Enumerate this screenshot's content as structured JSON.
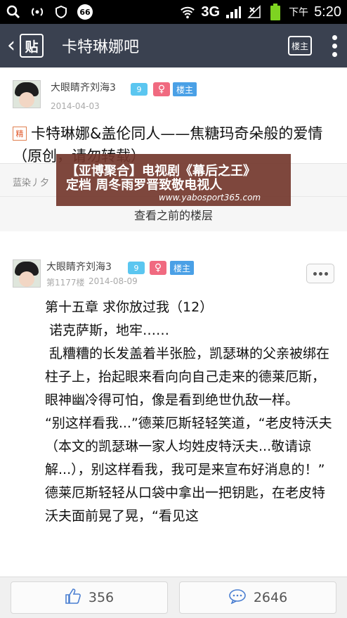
{
  "status_bar": {
    "notification_count": "66",
    "network": "3G",
    "time_prefix": "下午",
    "time": "5:20"
  },
  "app_bar": {
    "logo_text": "贴",
    "title": "卡特琳娜吧",
    "host_only_label": "楼主"
  },
  "post": {
    "author": "大眼睛齐刘海3",
    "level": "9",
    "gender_symbol": "♀",
    "host_tag": "楼主",
    "date": "2014-04-03",
    "essence_tag": "精",
    "title": "卡特琳娜&盖伦同人——焦糖玛奇朵般的爱情（原创，请勿转载）",
    "forum_row": "蓝染丿夕"
  },
  "view_previous_label": "查看之前的楼层",
  "floor": {
    "author": "大眼睛齐刘海3",
    "level": "9",
    "gender_symbol": "♀",
    "host_tag": "楼主",
    "floor_no": "第1177楼",
    "date": "2014-08-09",
    "lines": [
      "第十五章 求你放过我（12）",
      " 诺克萨斯，地牢……",
      " 乱糟糟的长发盖着半张脸，凯瑟琳的父亲被绑在柱子上，抬起眼来看向向自己走来的德莱厄斯，眼神幽冷得可怕，像是看到绝世仇敌一样。",
      "“别这样看我...”德莱厄斯轻轻笑道，“老皮特沃夫（本文的凯瑟琳一家人均姓皮特沃夫...敬请谅解...），别这样看我，我可是来宣布好消息的！”",
      "德莱厄斯轻轻从口袋中拿出一把钥匙，在老皮特沃夫面前晃了晃，“看见这"
    ]
  },
  "overlay": {
    "line1": "【亚博聚合】电视剧《幕后之王》",
    "line2": "定档 周冬雨罗晋致敬电视人",
    "url": "www.yabosport365.com"
  },
  "bottom_bar": {
    "like_count": "356",
    "comment_count": "2646"
  },
  "colors": {
    "app_bar": "#3a4150",
    "host_tag": "#4aa0e6",
    "level_badge": "#5bc6f0",
    "gender_badge": "#f06a80",
    "icon_blue": "#4b7fd1"
  }
}
